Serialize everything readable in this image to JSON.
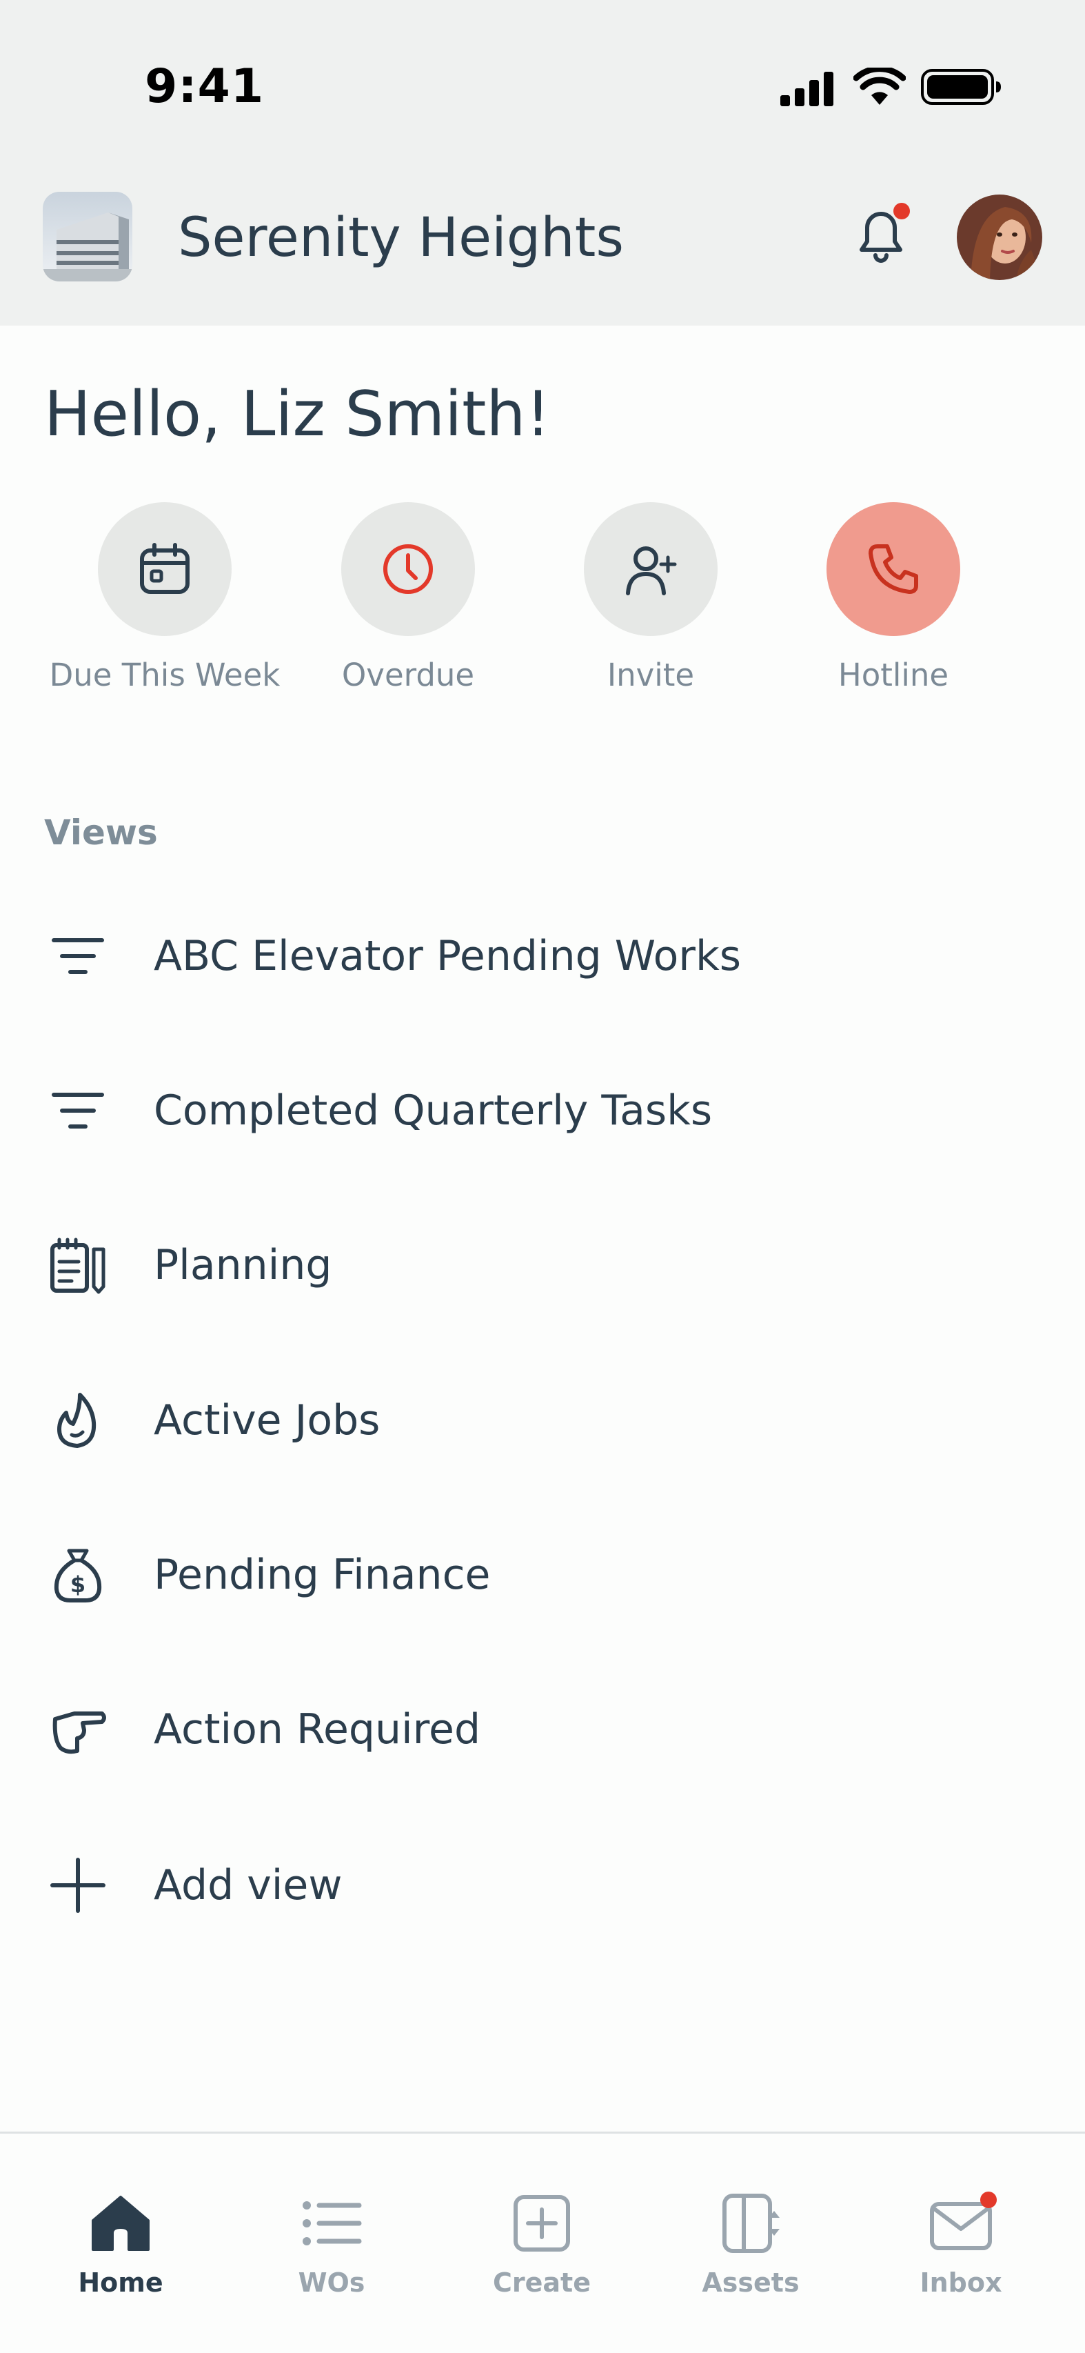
{
  "status_bar": {
    "time": "9:41"
  },
  "header": {
    "property_name": "Serenity Heights"
  },
  "greeting": "Hello, Liz Smith!",
  "quick_actions": [
    {
      "label": "Due This Week",
      "icon": "calendar-icon"
    },
    {
      "label": "Overdue",
      "icon": "clock-icon"
    },
    {
      "label": "Invite",
      "icon": "user-plus-icon"
    },
    {
      "label": "Hotline",
      "icon": "phone-icon"
    }
  ],
  "views": {
    "title": "Views",
    "items": [
      {
        "label": "ABC Elevator Pending Works",
        "icon": "filter-icon"
      },
      {
        "label": "Completed Quarterly Tasks",
        "icon": "filter-icon"
      },
      {
        "label": "Planning",
        "icon": "notebook-icon"
      },
      {
        "label": "Active Jobs",
        "icon": "flame-icon"
      },
      {
        "label": "Pending Finance",
        "icon": "money-bag-icon"
      },
      {
        "label": "Action Required",
        "icon": "pointing-hand-icon"
      }
    ],
    "add_label": "Add view"
  },
  "tabs": [
    {
      "label": "Home",
      "icon": "home-icon",
      "active": true
    },
    {
      "label": "WOs",
      "icon": "list-icon",
      "active": false
    },
    {
      "label": "Create",
      "icon": "plus-square-icon",
      "active": false
    },
    {
      "label": "Assets",
      "icon": "assets-icon",
      "active": false
    },
    {
      "label": "Inbox",
      "icon": "mail-icon",
      "active": false
    }
  ],
  "colors": {
    "text": "#2b3d4c",
    "muted": "#7b8995",
    "accent_red": "#e3392a",
    "hotline_bg": "#f09b8e",
    "header_bg": "#eff1f0"
  }
}
